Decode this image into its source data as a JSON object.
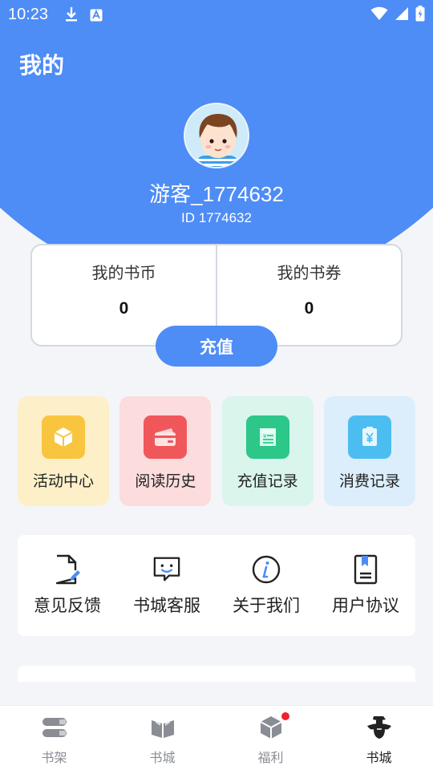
{
  "status_bar": {
    "time": "10:23"
  },
  "page": {
    "title": "我的"
  },
  "user": {
    "name": "游客_1774632",
    "id_text": "ID 1774632"
  },
  "wallet": {
    "coins": {
      "label": "我的书币",
      "value": "0"
    },
    "vouchers": {
      "label": "我的书券",
      "value": "0"
    },
    "recharge_label": "充值"
  },
  "quick_actions": [
    {
      "label": "活动中心",
      "icon": "cube-box-icon",
      "bg": "#fdf0c9",
      "icon_bg": "#f9c53f"
    },
    {
      "label": "阅读历史",
      "icon": "wallet-card-icon",
      "bg": "#fcdcdc",
      "icon_bg": "#f0575b"
    },
    {
      "label": "充值记录",
      "icon": "receipt-icon",
      "bg": "#d9f5ec",
      "icon_bg": "#2cc789"
    },
    {
      "label": "消费记录",
      "icon": "yen-clipboard-icon",
      "bg": "#dceefb",
      "icon_bg": "#4cbdf1"
    }
  ],
  "services": [
    {
      "label": "意见反馈",
      "icon": "feedback-edit-icon"
    },
    {
      "label": "书城客服",
      "icon": "customer-service-chat-icon"
    },
    {
      "label": "关于我们",
      "icon": "info-icon"
    },
    {
      "label": "用户协议",
      "icon": "agreement-bookmark-icon"
    }
  ],
  "tabs": [
    {
      "label": "书架",
      "icon": "bookshelf-icon",
      "active": false
    },
    {
      "label": "书城",
      "icon": "open-book-icon",
      "active": false
    },
    {
      "label": "福利",
      "icon": "gift-box-icon",
      "active": false,
      "badge": true
    },
    {
      "label": "书城",
      "icon": "scholar-hat-icon",
      "active": true
    }
  ],
  "colors": {
    "primary": "#4e8cf6",
    "page_bg": "#f4f5f9",
    "badge_red": "#f0212e"
  }
}
